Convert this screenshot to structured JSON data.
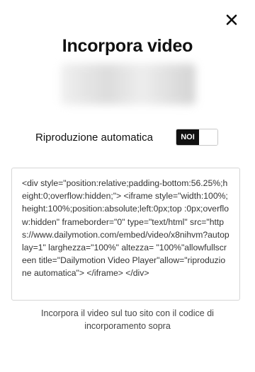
{
  "dialog": {
    "title": "Incorpora video",
    "close_icon": "close-icon"
  },
  "autoplay": {
    "label": "Riproduzione automatica",
    "toggle_state": "NOI"
  },
  "embed": {
    "code": "<div style=\"position:relative;padding-bottom:56.25%;height:0;overflow:hidden;\"> <iframe style=\"width:100%;height:100%;position:absolute;left:0px;top :0px;overflow:hidden\" frameborder=\"0\" type=\"text/html\" src=\"https://www.dailymotion.com/embed/video/x8nihvm?autoplay=1\" larghezza=\"100%\" altezza= \"100%\"allowfullscreen title=\"Dailymotion Video Player\"allow=\"riproduzione automatica\"> </iframe> </div>",
    "caption": "Incorpora il video sul tuo sito con il codice di incorporamento sopra"
  },
  "colors": {
    "toggle_active": "#111111",
    "border": "#d6d6d6"
  }
}
